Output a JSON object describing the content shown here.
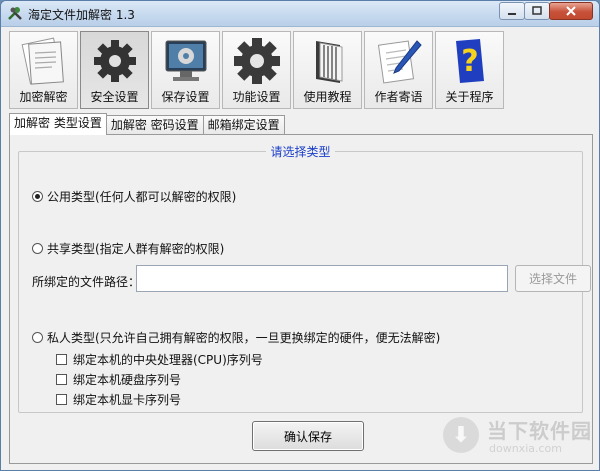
{
  "window": {
    "title": "海定文件加解密 1.3"
  },
  "toolbar": {
    "items": [
      {
        "label": "加密解密",
        "icon": "document-icon"
      },
      {
        "label": "安全设置",
        "icon": "gear-icon"
      },
      {
        "label": "保存设置",
        "icon": "monitor-gear-icon"
      },
      {
        "label": "功能设置",
        "icon": "large-gear-icon"
      },
      {
        "label": "使用教程",
        "icon": "book-icon"
      },
      {
        "label": "作者寄语",
        "icon": "pen-paper-icon"
      },
      {
        "label": "关于程序",
        "icon": "question-icon"
      }
    ],
    "active_index": 1
  },
  "tabs": {
    "items": [
      "加解密 类型设置",
      "加解密 密码设置",
      "邮箱绑定设置"
    ],
    "active_index": 0
  },
  "panel": {
    "group_title": "请选择类型",
    "options": {
      "public": "公用类型(任何人都可以解密的权限)",
      "shared": "共享类型(指定人群有解密的权限)",
      "private": "私人类型(只允许自己拥有解密的权限，一旦更换绑定的硬件，便无法解密)"
    },
    "selected_option": "public",
    "path_label": "所绑定的文件路径：",
    "path_value": "",
    "browse_button": "选择文件",
    "checkboxes": [
      "绑定本机的中央处理器(CPU)序列号",
      "绑定本机硬盘序列号",
      "绑定本机显卡序列号"
    ],
    "save_button": "确认保存"
  },
  "watermark": {
    "title": "当下软件园",
    "subtitle": "downxia.com"
  }
}
